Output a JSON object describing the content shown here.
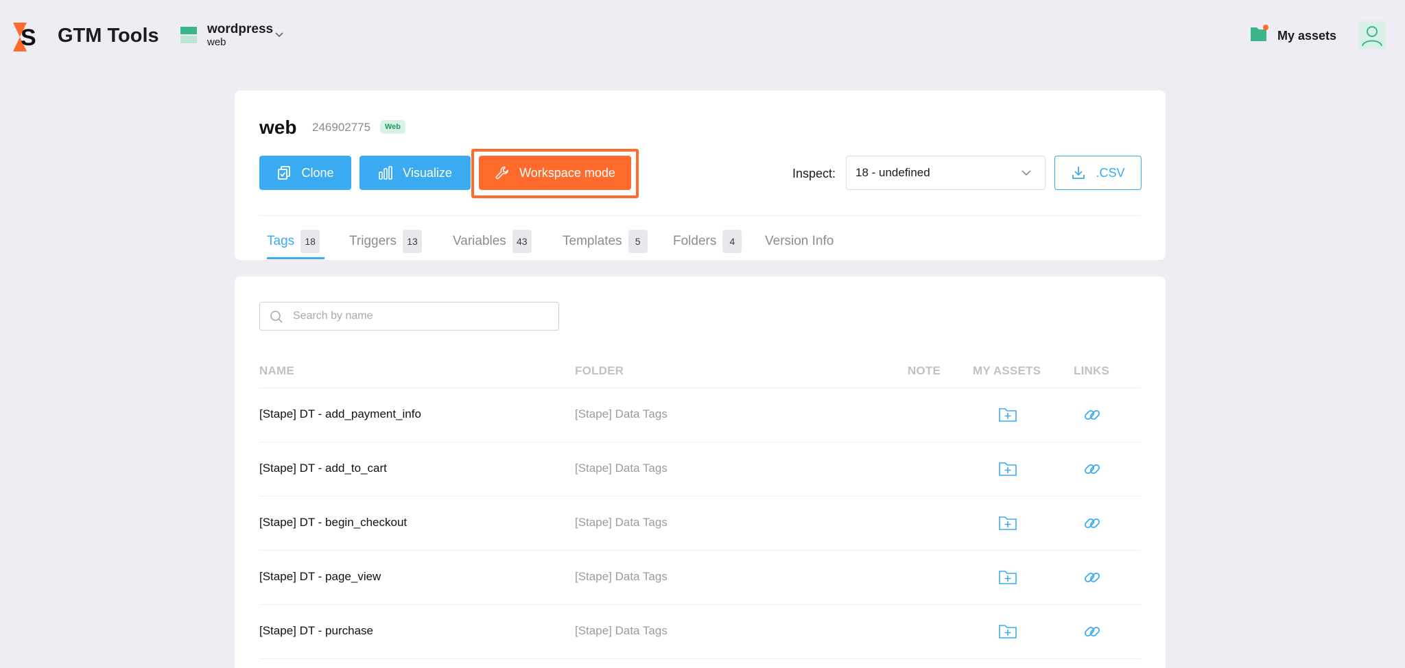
{
  "app": {
    "title": "GTM Tools",
    "workspace_name": "wordpress",
    "workspace_type": "web",
    "assets_label": "My assets",
    "colors": {
      "accent": "#3aabf0",
      "orange": "#ff6a2d",
      "green": "#3bb58a"
    }
  },
  "container": {
    "name": "web",
    "id": "246902775",
    "badge": "Web"
  },
  "toolbar": {
    "clone_label": "Clone",
    "visualize_label": "Visualize",
    "workspace_label": "Workspace mode",
    "inspect_label": "Inspect:",
    "inspect_value": "18 - undefined",
    "csv_label": ".CSV"
  },
  "tabs": [
    {
      "label": "Tags",
      "count": "18",
      "active": true
    },
    {
      "label": "Triggers",
      "count": "13"
    },
    {
      "label": "Variables",
      "count": "43"
    },
    {
      "label": "Templates",
      "count": "5"
    },
    {
      "label": "Folders",
      "count": "4"
    },
    {
      "label": "Version Info"
    }
  ],
  "search": {
    "placeholder": "Search by name",
    "value": ""
  },
  "table": {
    "columns": [
      "NAME",
      "FOLDER",
      "NOTE",
      "MY ASSETS",
      "LINKS"
    ],
    "rows": [
      {
        "name": "[Stape] DT - add_payment_info",
        "folder": "[Stape] Data Tags"
      },
      {
        "name": "[Stape] DT - add_to_cart",
        "folder": "[Stape] Data Tags"
      },
      {
        "name": "[Stape] DT - begin_checkout",
        "folder": "[Stape] Data Tags"
      },
      {
        "name": "[Stape] DT - page_view",
        "folder": "[Stape] Data Tags"
      },
      {
        "name": "[Stape] DT - purchase",
        "folder": "[Stape] Data Tags"
      }
    ]
  }
}
